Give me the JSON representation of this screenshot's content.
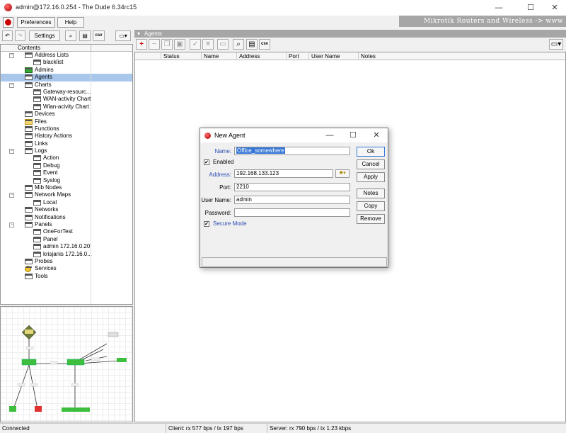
{
  "window": {
    "title": "admin@172.16.0.254 - The Dude 6.34rc15",
    "minimize": "—",
    "maximize": "☐",
    "close": "✕"
  },
  "menubar": {
    "preferences": "Preferences",
    "help": "Help"
  },
  "brand": "Mikrotik Routers and Wireless -> www",
  "left_toolbar": {
    "settings": "Settings",
    "csv": "csv"
  },
  "tree": {
    "header": "Contents",
    "items": [
      {
        "label": "Address Lists",
        "indent": 0,
        "exp": "−",
        "icon": "list"
      },
      {
        "label": "blacklist",
        "indent": 1,
        "exp": "",
        "icon": "list"
      },
      {
        "label": "Admins",
        "indent": 0,
        "exp": "",
        "icon": "admin"
      },
      {
        "label": "Agents",
        "indent": 0,
        "exp": "",
        "icon": "list",
        "selected": true
      },
      {
        "label": "Charts",
        "indent": 0,
        "exp": "−",
        "icon": "list"
      },
      {
        "label": "Gateway-resourc...",
        "indent": 1,
        "exp": "",
        "icon": "list"
      },
      {
        "label": "WAN-activity Chart",
        "indent": 1,
        "exp": "",
        "icon": "list"
      },
      {
        "label": "Wlan-acivity Chart",
        "indent": 1,
        "exp": "",
        "icon": "list"
      },
      {
        "label": "Devices",
        "indent": 0,
        "exp": "",
        "icon": "list"
      },
      {
        "label": "Files",
        "indent": 0,
        "exp": "",
        "icon": "folder"
      },
      {
        "label": "Functions",
        "indent": 0,
        "exp": "",
        "icon": "list"
      },
      {
        "label": "History Actions",
        "indent": 0,
        "exp": "",
        "icon": "list"
      },
      {
        "label": "Links",
        "indent": 0,
        "exp": "",
        "icon": "list"
      },
      {
        "label": "Logs",
        "indent": 0,
        "exp": "−",
        "icon": "list"
      },
      {
        "label": "Action",
        "indent": 1,
        "exp": "",
        "icon": "chart"
      },
      {
        "label": "Debug",
        "indent": 1,
        "exp": "",
        "icon": "chart"
      },
      {
        "label": "Event",
        "indent": 1,
        "exp": "",
        "icon": "chart"
      },
      {
        "label": "Syslog",
        "indent": 1,
        "exp": "",
        "icon": "chart"
      },
      {
        "label": "Mib Nodes",
        "indent": 0,
        "exp": "",
        "icon": "list"
      },
      {
        "label": "Network Maps",
        "indent": 0,
        "exp": "−",
        "icon": "list"
      },
      {
        "label": "Local",
        "indent": 1,
        "exp": "",
        "icon": "list"
      },
      {
        "label": "Networks",
        "indent": 0,
        "exp": "",
        "icon": "list"
      },
      {
        "label": "Notifications",
        "indent": 0,
        "exp": "",
        "icon": "list"
      },
      {
        "label": "Panels",
        "indent": 0,
        "exp": "−",
        "icon": "list"
      },
      {
        "label": "OneForTest",
        "indent": 1,
        "exp": "",
        "icon": "list"
      },
      {
        "label": "Panel",
        "indent": 1,
        "exp": "",
        "icon": "list"
      },
      {
        "label": "admin 172.16.0.20",
        "indent": 1,
        "exp": "",
        "icon": "list"
      },
      {
        "label": "krisjanis 172.16.0...",
        "indent": 1,
        "exp": "",
        "icon": "list"
      },
      {
        "label": "Probes",
        "indent": 0,
        "exp": "",
        "icon": "list"
      },
      {
        "label": "Services",
        "indent": 0,
        "exp": "",
        "icon": "gear"
      },
      {
        "label": "Tools",
        "indent": 0,
        "exp": "",
        "icon": "list"
      }
    ]
  },
  "agents_panel": {
    "title": "Agents",
    "columns": [
      "Status",
      "Name",
      "Address",
      "Port",
      "User Name",
      "Notes"
    ]
  },
  "dialog": {
    "title": "New Agent",
    "name_label": "Name:",
    "name_value": "Office_somewhere",
    "enabled_label": "Enabled",
    "address_label": "Address:",
    "address_value": "192.168.133.123",
    "port_label": "Port:",
    "port_value": "2210",
    "username_label": "User Name:",
    "username_value": "admin",
    "password_label": "Password:",
    "password_value": "",
    "secure_label": "Secure Mode",
    "buttons": {
      "ok": "Ok",
      "cancel": "Cancel",
      "apply": "Apply",
      "notes": "Notes",
      "copy": "Copy",
      "remove": "Remove"
    }
  },
  "status": {
    "connected": "Connected",
    "client": "Client: rx 577 bps / tx 197 bps",
    "server": "Server: rx 790 bps / tx 1.23 kbps"
  }
}
